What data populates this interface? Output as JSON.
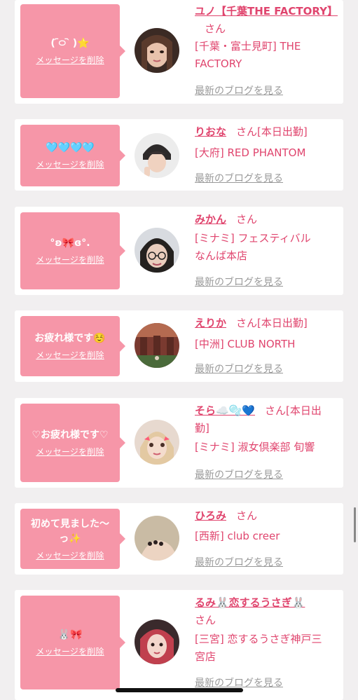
{
  "delete_label": "メッセージを削除",
  "blog_label": "最新のブログを見る",
  "san_label": "さん",
  "colors": {
    "bubble": "#f696a8",
    "accent": "#e0456e",
    "muted": "#9a9a9a",
    "background": "#f1eff0"
  },
  "cards": [
    {
      "message": "( ᷇࿀ ᷆ )⭐️",
      "name": "ユノ【千葉THE FACTORY】",
      "shop_line1": "[千葉・富士見町] THE",
      "shop_line2": "FACTORY"
    },
    {
      "message": "🩵🩵🩵🩵",
      "name": "りおな",
      "status": "[本日出勤]",
      "shop_line1": "[大府] RED PHANTOM"
    },
    {
      "message": "°ʚ🎀ɞ°.",
      "name": "みかん",
      "shop_line1": "[ミナミ] フェスティバル",
      "shop_line2": "なんば本店"
    },
    {
      "message": "お疲れ様です☺️",
      "name": "えりか",
      "status": "[本日出勤]",
      "shop_line1": "[中洲] CLUB NORTH"
    },
    {
      "message": "♡お疲れ様です♡",
      "name": "そら☁️🫧💙",
      "status_a": "[本日出",
      "status_b": "勤]",
      "shop_line1": "[ミナミ] 淑女倶楽部 旬響"
    },
    {
      "message_line1": "初めて見ました〜",
      "message_line2": "っ✨",
      "name": "ひろみ",
      "shop_line1": "[西新] club creer"
    },
    {
      "message": "🐰🎀",
      "name": "るみ🐰恋するうさぎ🐰",
      "shop_line1": "[三宮] 恋するうさぎ神戸三",
      "shop_line2": "宮店"
    }
  ]
}
